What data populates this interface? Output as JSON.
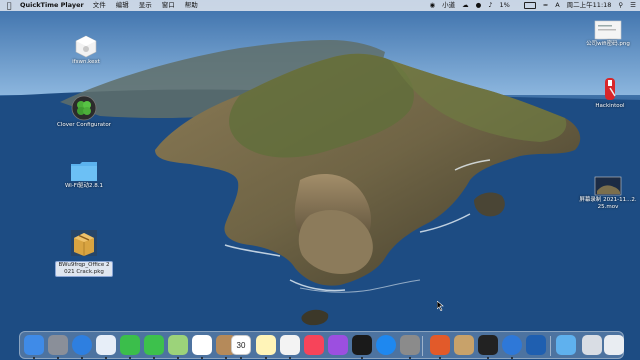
{
  "menubar": {
    "app_name": "QuickTime Player",
    "menus": [
      "文件",
      "编辑",
      "显示",
      "窗口",
      "帮助"
    ],
    "status": {
      "user": "小道",
      "battery": "1%",
      "datetime": "周二上午11:18"
    }
  },
  "desktop_left": [
    {
      "label": "ifswn.kext",
      "icon": "kext-file-icon"
    },
    {
      "label": "Clover Configurator",
      "icon": "clover-icon"
    },
    {
      "label": "Wi-Fi驱动2.8.1",
      "icon": "folder-icon"
    },
    {
      "label": "BWu9frqp_Office 2021 Crack.pkg",
      "icon": "package-icon"
    }
  ],
  "desktop_right": [
    {
      "label": "公司wifi密码.png",
      "icon": "image-file-icon"
    },
    {
      "label": "Hackintool",
      "icon": "hackintool-icon"
    },
    {
      "label": "屏幕录制 2021-11...2.25.mov",
      "icon": "video-file-icon"
    }
  ],
  "dock": {
    "apps": [
      {
        "name": "finder-icon",
        "bg": "#3f8be8"
      },
      {
        "name": "launchpad-icon",
        "bg": "#8a8f99"
      },
      {
        "name": "safari-icon",
        "bg": "#2e7fe0"
      },
      {
        "name": "photos-app-icon",
        "bg": "#e7eef8"
      },
      {
        "name": "facetime-icon",
        "bg": "#3bbe4b"
      },
      {
        "name": "messages-icon",
        "bg": "#3dc14c"
      },
      {
        "name": "maps-icon",
        "bg": "#9cd37a"
      },
      {
        "name": "photos-icon",
        "bg": "#ffffff"
      },
      {
        "name": "contacts-icon",
        "bg": "#b58a5a"
      },
      {
        "name": "calendar-icon",
        "bg": "#ffffff"
      },
      {
        "name": "notes-icon",
        "bg": "#fff4b8"
      },
      {
        "name": "reminders-icon",
        "bg": "#f3f3f3"
      },
      {
        "name": "music-icon",
        "bg": "#f7445a"
      },
      {
        "name": "podcasts-icon",
        "bg": "#9c4fe0"
      },
      {
        "name": "apple-tv-icon",
        "bg": "#1a1a1a"
      },
      {
        "name": "app-store-icon",
        "bg": "#1e88f0"
      },
      {
        "name": "system-preferences-icon",
        "bg": "#8b8b8b"
      },
      {
        "name": "office-icon",
        "bg": "#e25a2a"
      },
      {
        "name": "archive-utility-icon",
        "bg": "#c8a26a"
      },
      {
        "name": "terminal-icon",
        "bg": "#222222"
      },
      {
        "name": "quicktime-icon",
        "bg": "#2e78d8"
      },
      {
        "name": "screen-capture-icon",
        "bg": "#1f5fb0"
      },
      {
        "name": "downloads-folder-icon",
        "bg": "#5fb1ee"
      },
      {
        "name": "desktop-stack-icon",
        "bg": "#d9dde4"
      },
      {
        "name": "trash-icon",
        "bg": "#e9edf2"
      }
    ],
    "calendar_day": "30"
  }
}
